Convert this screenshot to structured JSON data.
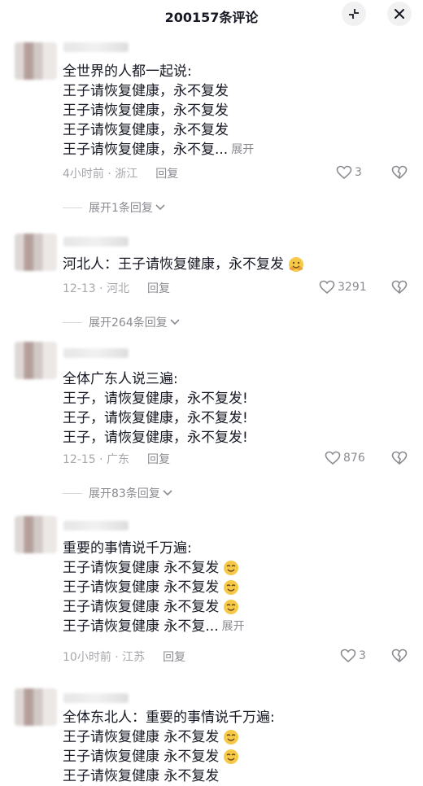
{
  "header": {
    "title": "200157条评论",
    "collapse_icon": "collapse-icon",
    "close_icon": "close-icon"
  },
  "comments": [
    {
      "lines": [
        "全世界的人都一起说:",
        "王子请恢复健康，永不复发",
        "王子请恢复健康，永不复发",
        "王子请恢复健康，永不复发",
        "王子请恢复健康，永不复..."
      ],
      "expand": "展开",
      "meta": "4小时前 · 浙江",
      "reply": "回复",
      "likes": "3",
      "more": "展开1条回复"
    },
    {
      "lines": [
        "河北人：王子请恢复健康，永不复发"
      ],
      "emoji_line": 0,
      "emoji": "hug-emoji",
      "meta": "12-13 · 河北",
      "reply": "回复",
      "likes": "3291",
      "more": "展开264条回复"
    },
    {
      "lines": [
        "全体广东人说三遍:",
        "王子，请恢复健康，永不复发!",
        "王子，请恢复健康，永不复发!",
        "王子，请恢复健康，永不复发!"
      ],
      "meta": "12-15 · 广东",
      "reply": "回复",
      "likes": "876",
      "more": "展开83条回复"
    },
    {
      "lines": [
        "重要的事情说千万遍:",
        "王子请恢复健康 永不复发",
        "王子请恢复健康 永不复发",
        "王子请恢复健康 永不复发",
        "王子请恢复健康 永不复..."
      ],
      "expand": "展开",
      "emoji": "smile-emoji",
      "meta": "10小时前 · 江苏",
      "reply": "回复",
      "likes": "3"
    },
    {
      "lines": [
        "全体东北人：重要的事情说千万遍:",
        "王子请恢复健康 永不复发",
        "王子请恢复健康 永不复发",
        "王子请恢复健康 永不复发"
      ],
      "emoji": "smile-emoji"
    }
  ],
  "colors": {
    "text": "#161823",
    "meta": "#a6a7ab",
    "secondary": "#8a8b91",
    "emoji": "#f7c948"
  }
}
